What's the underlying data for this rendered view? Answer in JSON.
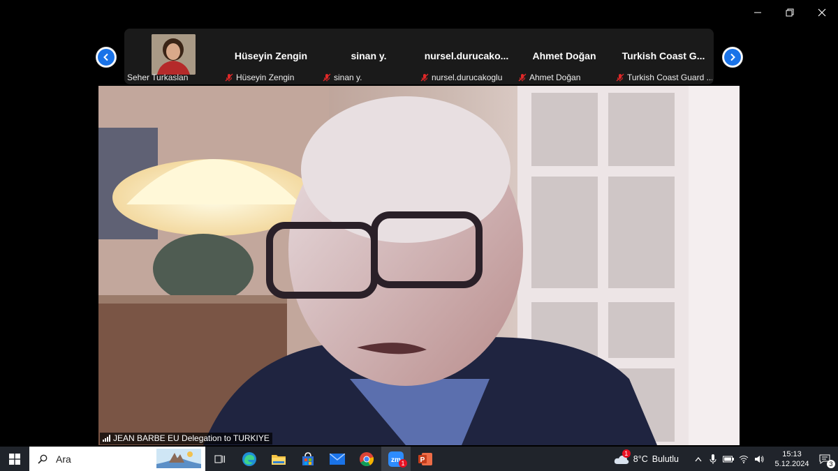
{
  "gallery": {
    "tiles": [
      {
        "name": "",
        "footer": "Seher Turkaslan",
        "muted": false
      },
      {
        "name": "Hüseyin Zengin",
        "footer": "Hüseyin Zengin",
        "muted": true
      },
      {
        "name": "sinan y.",
        "footer": "sinan y.",
        "muted": true
      },
      {
        "name": "nursel.durucako...",
        "footer": "nursel.durucakoglu",
        "muted": true
      },
      {
        "name": "Ahmet Doğan",
        "footer": "Ahmet Doğan",
        "muted": true
      },
      {
        "name": "Turkish Coast G...",
        "footer": "Turkish Coast Guard ...",
        "muted": true
      }
    ]
  },
  "main_video": {
    "speaker_label": "JEAN BARBE EU Delegation to TURKIYE"
  },
  "taskbar": {
    "search_placeholder": "Ara",
    "weather_temp": "8°C",
    "weather_text": "Bulutlu",
    "weather_badge": "1",
    "zoom_badge": "1",
    "time": "15:13",
    "date": "5.12.2024",
    "notification_count": "3"
  },
  "colors": {
    "accent_blue": "#1a73e8",
    "mute_red": "#e02828",
    "taskbar_bg": "#20242b",
    "strip_bg": "#1a1a1a"
  }
}
